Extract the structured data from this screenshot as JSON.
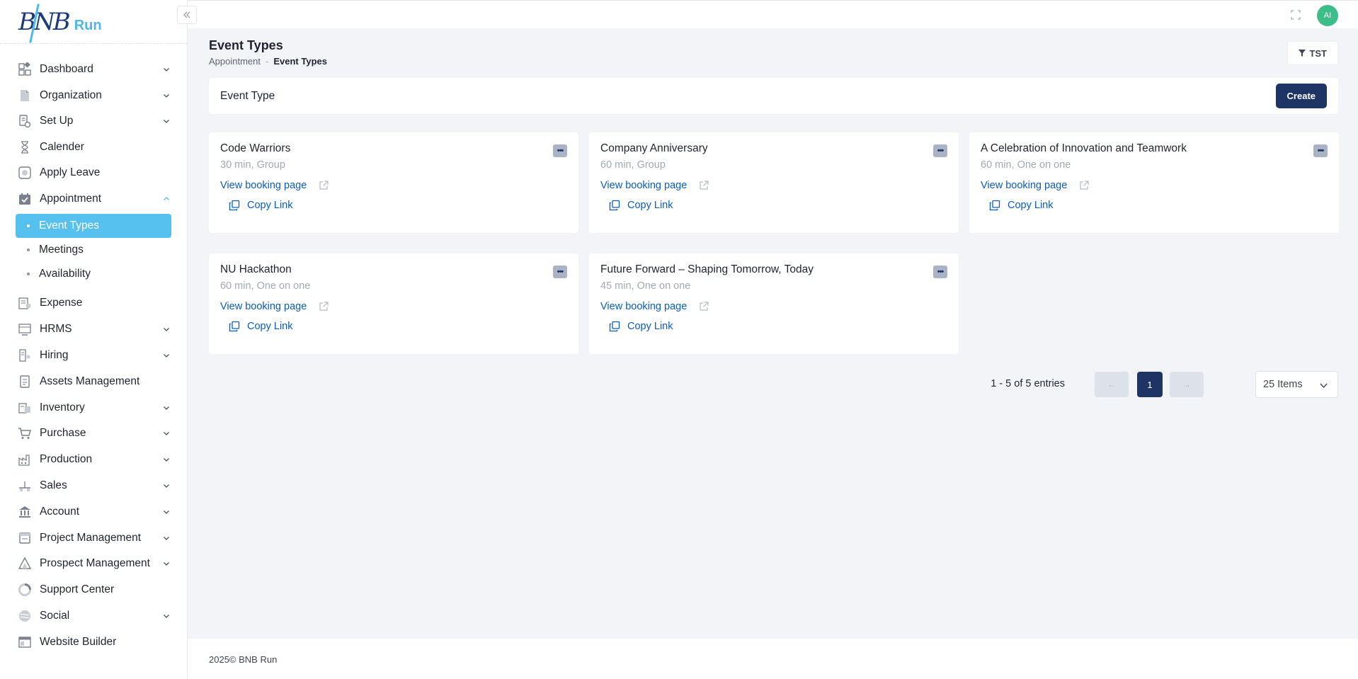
{
  "brand": {
    "logo_mark": "BNB",
    "logo_run": "Run"
  },
  "sidebar": {
    "items": [
      {
        "label": "Dashboard",
        "icon": "dashboard-icon",
        "chevron": "down"
      },
      {
        "label": "Organization",
        "icon": "document-icon",
        "chevron": "down"
      },
      {
        "label": "Set Up",
        "icon": "setup-icon",
        "chevron": "down"
      },
      {
        "label": "Calender",
        "icon": "hourglass-icon",
        "chevron": ""
      },
      {
        "label": "Apply Leave",
        "icon": "leave-icon",
        "chevron": ""
      },
      {
        "label": "Appointment",
        "icon": "calendar-check-icon",
        "chevron": "up"
      }
    ],
    "sub_items": [
      {
        "label": "Event Types",
        "active": true
      },
      {
        "label": "Meetings",
        "active": false
      },
      {
        "label": "Availability",
        "active": false
      }
    ],
    "items_after": [
      {
        "label": "Expense",
        "icon": "expense-icon",
        "chevron": ""
      },
      {
        "label": "HRMS",
        "icon": "hrms-icon",
        "chevron": "down"
      },
      {
        "label": "Hiring",
        "icon": "hiring-icon",
        "chevron": "down"
      },
      {
        "label": "Assets Management",
        "icon": "assets-icon",
        "chevron": ""
      },
      {
        "label": "Inventory",
        "icon": "inventory-icon",
        "chevron": "down"
      },
      {
        "label": "Purchase",
        "icon": "cart-icon",
        "chevron": "down"
      },
      {
        "label": "Production",
        "icon": "factory-icon",
        "chevron": "down"
      },
      {
        "label": "Sales",
        "icon": "sales-icon",
        "chevron": "down"
      },
      {
        "label": "Account",
        "icon": "bank-icon",
        "chevron": "down"
      },
      {
        "label": "Project Management",
        "icon": "project-icon",
        "chevron": "down"
      },
      {
        "label": "Prospect Management",
        "icon": "prospect-icon",
        "chevron": "down"
      },
      {
        "label": "Support Center",
        "icon": "support-icon",
        "chevron": ""
      },
      {
        "label": "Social",
        "icon": "social-icon",
        "chevron": "down"
      },
      {
        "label": "Website Builder",
        "icon": "website-icon",
        "chevron": ""
      }
    ]
  },
  "topbar": {
    "avatar_initials": "AI"
  },
  "page": {
    "title": "Event Types",
    "breadcrumb_parent": "Appointment",
    "breadcrumb_sep": "-",
    "breadcrumb_current": "Event Types",
    "filter_label": "TST"
  },
  "header_card": {
    "title": "Event Type",
    "create_label": "Create"
  },
  "cards": [
    {
      "title": "Code Warriors",
      "meta": "30 min, Group",
      "view_label": "View booking page",
      "copy_label": "Copy Link"
    },
    {
      "title": "Company Anniversary",
      "meta": "60 min, Group",
      "view_label": "View booking page",
      "copy_label": "Copy Link"
    },
    {
      "title": "A Celebration of Innovation and Teamwork",
      "meta": "60 min, One on one",
      "view_label": "View booking page",
      "copy_label": "Copy Link"
    },
    {
      "title": "NU Hackathon",
      "meta": "60 min, One on one",
      "view_label": "View booking page",
      "copy_label": "Copy Link"
    },
    {
      "title": "Future Forward – Shaping Tomorrow, Today",
      "meta": "45 min, One on one",
      "view_label": "View booking page",
      "copy_label": "Copy Link"
    }
  ],
  "card_menu_glyph": "•••",
  "pagination": {
    "entries_text": "1 - 5 of 5 entries",
    "prev_label": "←",
    "current_page": "1",
    "next_label": "→",
    "page_size": "25 Items"
  },
  "footer": {
    "text": "2025© BNB Run"
  },
  "colors": {
    "accent": "#56c1ee",
    "primary": "#1d3465",
    "link": "#0a5db8"
  }
}
